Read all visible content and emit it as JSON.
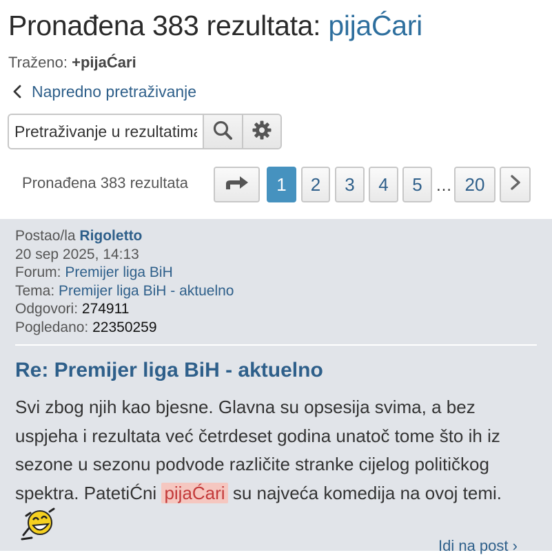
{
  "header": {
    "title_prefix": "Pronađena 383 rezultata: ",
    "title_query": "pijaĆari",
    "searched_label": "Traženo:",
    "searched_term": "+pijaĆari",
    "advanced_search": "Napredno pretraživanje"
  },
  "search": {
    "placeholder": "Pretraživanje u rezultatima",
    "search_icon": "search-icon",
    "settings_icon": "gear-icon"
  },
  "pagination": {
    "count_text": "Pronađena 383 rezultata",
    "jump_icon": "share-arrow-icon",
    "pages": [
      "1",
      "2",
      "3",
      "4",
      "5"
    ],
    "current_page": "1",
    "ellipsis": "…",
    "last_page": "20",
    "next_icon": "chevron-right-icon"
  },
  "post": {
    "posted_by_label": "Postao/la",
    "author": "Rigoletto",
    "date": "20 sep 2025, 14:13",
    "forum_label": "Forum:",
    "forum": "Premijer liga BiH",
    "topic_label": "Tema:",
    "topic": "Premijer liga BiH - aktuelno",
    "replies_label": "Odgovori:",
    "replies": "274911",
    "views_label": "Pogledano:",
    "views": "22350259",
    "title": "Re: Premijer liga BiH - aktuelno",
    "body_before": "Svi zbog njih kao bjesne. Glavna su opsesija svima, a bez uspjeha i rezultata već četrdeset godina unatoč tome što ih iz sezone u sezonu podvode različite stranke cijelog političkog spektra. PatetiĆni ",
    "body_highlight": "pijaĆari",
    "body_after": " su najveća komedija na ovoj temi.",
    "smiley_icon": "laughing-smiley-icon",
    "goto_post": "Idi na post ›"
  },
  "colors": {
    "link": "#2e5f8a",
    "active_page": "#4692bf",
    "post_bg": "#e1e4e9",
    "highlight_bg": "#f5c7c0",
    "highlight_text": "#c33a3a"
  }
}
